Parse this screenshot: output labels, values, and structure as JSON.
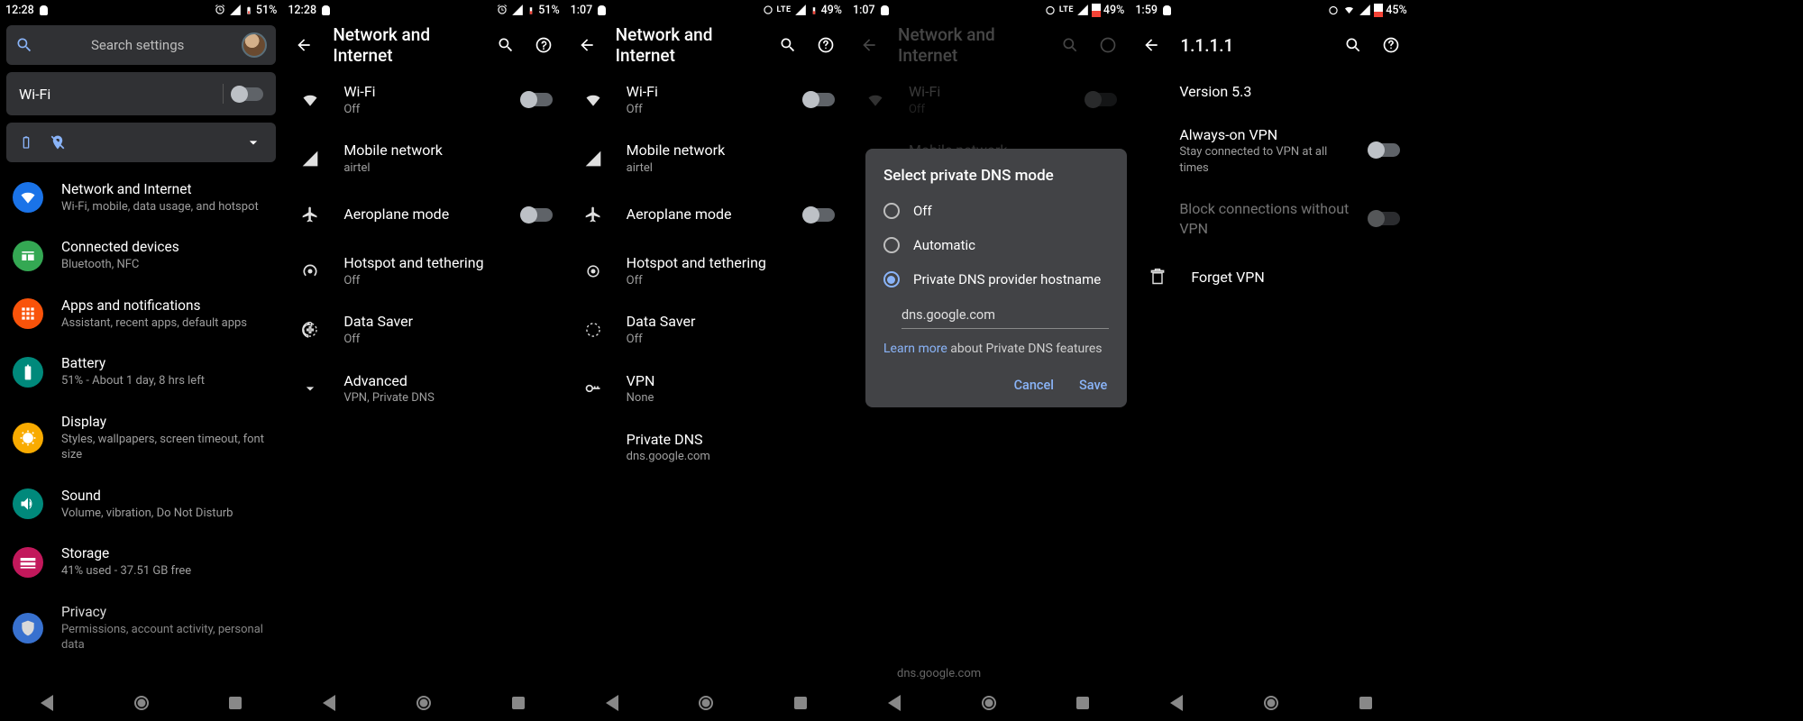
{
  "status": {
    "time_a": "12:28",
    "time_b": "1:07",
    "time_c": "1:59",
    "batt_a": "51%",
    "batt_b": "49%",
    "batt_c": "45%",
    "lte": "LTE"
  },
  "settings_main": {
    "search_placeholder": "Search settings",
    "wifi_quick": "Wi-Fi",
    "items": [
      {
        "title": "Network and Internet",
        "sub": "Wi-Fi, mobile, data usage, and hotspot",
        "color": "#1a73e8"
      },
      {
        "title": "Connected devices",
        "sub": "Bluetooth, NFC",
        "color": "#34a853"
      },
      {
        "title": "Apps and notifications",
        "sub": "Assistant, recent apps, default apps",
        "color": "#f9ab00"
      },
      {
        "title": "Battery",
        "sub": "51% - About 1 day, 8 hrs left",
        "color": "#00897b"
      },
      {
        "title": "Display",
        "sub": "Styles, wallpapers, screen timeout, font size",
        "color": "#f9ab00"
      },
      {
        "title": "Sound",
        "sub": "Volume, vibration, Do Not Disturb",
        "color": "#00897b"
      },
      {
        "title": "Storage",
        "sub": "41% used - 37.51 GB free",
        "color": "#c2185b"
      },
      {
        "title": "Privacy",
        "sub": "Permissions, account activity, personal data",
        "color": "#4285f4"
      }
    ]
  },
  "network": {
    "header": "Network and Internet",
    "wifi": "Wi-Fi",
    "off": "Off",
    "mobile": "Mobile network",
    "carrier": "airtel",
    "aero": "Aeroplane mode",
    "hotspot": "Hotspot and tethering",
    "saver": "Data Saver",
    "advanced": "Advanced",
    "advanced_sub": "VPN, Private DNS",
    "vpn": "VPN",
    "vpn_sub": "None",
    "pdns": "Private DNS",
    "pdns_val": "dns.google.com"
  },
  "dns_dialog": {
    "title": "Select private DNS mode",
    "opt_off": "Off",
    "opt_auto": "Automatic",
    "opt_host": "Private DNS provider hostname",
    "input_val": "dns.google.com",
    "learn_more": "Learn more",
    "learn_suffix": " about Private DNS features",
    "cancel": "Cancel",
    "save": "Save"
  },
  "vpn_page": {
    "header": "1.1.1.1",
    "version": "Version 5.3",
    "always": "Always-on VPN",
    "always_sub": "Stay connected to VPN at all times",
    "block": "Block connections without VPN",
    "forget": "Forget VPN"
  }
}
